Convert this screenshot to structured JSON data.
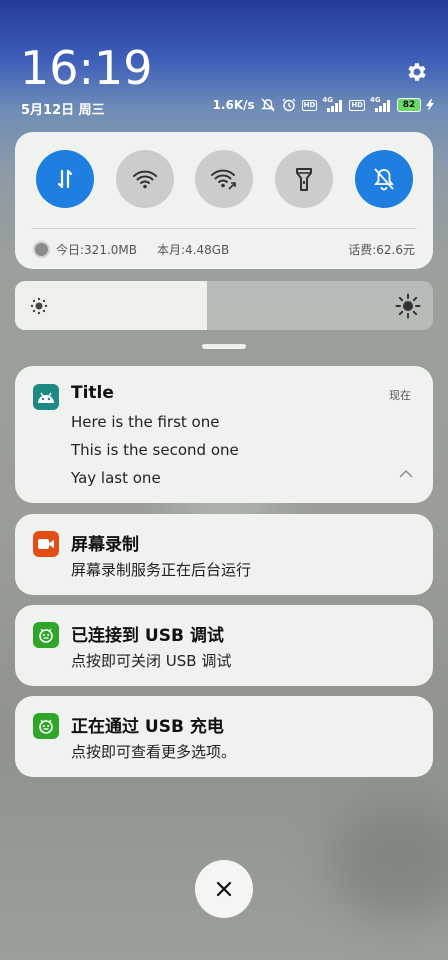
{
  "header": {
    "time": "16:19",
    "date": "5月12日 周三",
    "net_speed": "1.6K/s",
    "sim1_label": "4G",
    "sim2_label": "4G",
    "hd1": "HD",
    "hd2": "HD",
    "battery": "82"
  },
  "quick_settings": {
    "toggles": [
      {
        "name": "mobile-data",
        "state": "on"
      },
      {
        "name": "wifi",
        "state": "off"
      },
      {
        "name": "wifi-share",
        "state": "off"
      },
      {
        "name": "flashlight",
        "state": "off"
      },
      {
        "name": "mute",
        "state": "on"
      }
    ],
    "data_today": "今日:321.0MB",
    "data_month": "本月:4.48GB",
    "balance": "话费:62.6元"
  },
  "brightness": {
    "level_fraction": 0.46
  },
  "notifications": [
    {
      "id": "test",
      "title": "Title",
      "time": "现在",
      "lines": [
        "Here is the first one",
        "This is the second one",
        "Yay last one"
      ],
      "icon": "android-icon",
      "icon_color": "#1e8a83"
    },
    {
      "id": "screen-record",
      "title": "屏幕录制",
      "text": "屏幕录制服务正在后台运行",
      "icon": "video-camera-icon",
      "icon_color": "#e14d12"
    },
    {
      "id": "usb-debug",
      "title": "已连接到 USB 调试",
      "text": "点按即可关闭 USB 调试",
      "icon": "android-bug-icon",
      "icon_color": "#2fa62a"
    },
    {
      "id": "usb-charge",
      "title": "正在通过 USB 充电",
      "text": "点按即可查看更多选项。",
      "icon": "android-bug-icon",
      "icon_color": "#2fa62a"
    }
  ],
  "colors": {
    "accent": "#1f7fe0",
    "card": "#f0f2ef"
  }
}
